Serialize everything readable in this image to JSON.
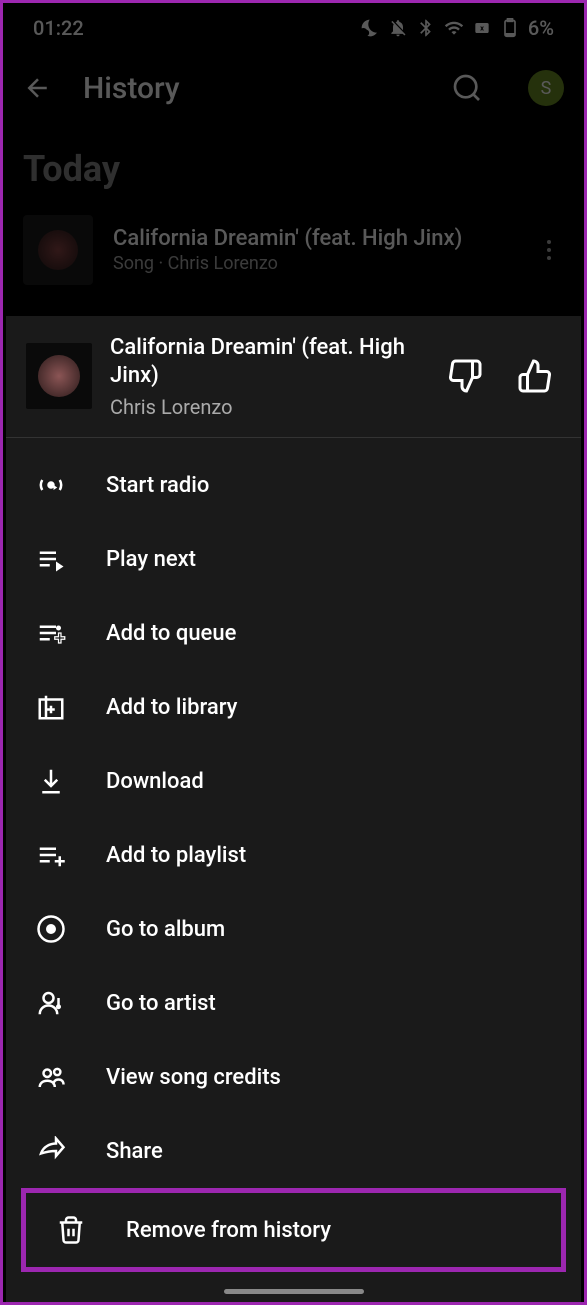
{
  "status": {
    "time": "01:22",
    "battery": "6%"
  },
  "header": {
    "title": "History",
    "avatar_letter": "S"
  },
  "section": {
    "title": "Today"
  },
  "history_item": {
    "title": "California Dreamin' (feat. High Jinx)",
    "subtitle": "Song · Chris Lorenzo"
  },
  "sheet": {
    "title": "California Dreamin' (feat. High Jinx)",
    "artist": "Chris Lorenzo"
  },
  "menu": {
    "start_radio": "Start radio",
    "play_next": "Play next",
    "add_to_queue": "Add to queue",
    "add_to_library": "Add to library",
    "download": "Download",
    "add_to_playlist": "Add to playlist",
    "go_to_album": "Go to album",
    "go_to_artist": "Go to artist",
    "view_credits": "View song credits",
    "share": "Share",
    "remove_history": "Remove from history"
  }
}
